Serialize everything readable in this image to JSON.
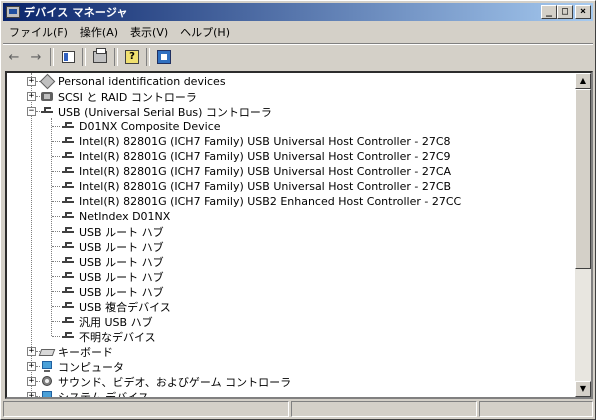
{
  "window": {
    "title": "デバイス マネージャ",
    "controls": {
      "minimize": "_",
      "maximize": "□",
      "close": "×"
    }
  },
  "menubar": {
    "items": [
      "ファイル(F)",
      "操作(A)",
      "表示(V)",
      "ヘルプ(H)"
    ]
  },
  "toolbar": {
    "back_icon": "back-arrow-icon",
    "forward_icon": "forward-arrow-icon",
    "buttons": [
      "properties-icon",
      "print-icon",
      "help-icon",
      "scan-hardware-icon"
    ],
    "back_glyph": "←",
    "forward_glyph": "→",
    "help_glyph": "?"
  },
  "tree": {
    "expand_collapsed": "+",
    "expand_open": "−",
    "nodes": [
      {
        "label": "Personal identification devices",
        "level": 0,
        "expander": "+",
        "icon": "diamond-icon"
      },
      {
        "label": "SCSI と RAID コントローラ",
        "level": 0,
        "expander": "+",
        "icon": "scsi-icon"
      },
      {
        "label": "USB (Universal Serial Bus) コントローラ",
        "level": 0,
        "expander": "−",
        "icon": "usb-icon"
      },
      {
        "label": "D01NX Composite Device",
        "level": 1,
        "icon": "usb-icon"
      },
      {
        "label": "Intel(R) 82801G (ICH7 Family) USB Universal Host Controller - 27C8",
        "level": 1,
        "icon": "usb-icon"
      },
      {
        "label": "Intel(R) 82801G (ICH7 Family) USB Universal Host Controller - 27C9",
        "level": 1,
        "icon": "usb-icon"
      },
      {
        "label": "Intel(R) 82801G (ICH7 Family) USB Universal Host Controller - 27CA",
        "level": 1,
        "icon": "usb-icon"
      },
      {
        "label": "Intel(R) 82801G (ICH7 Family) USB Universal Host Controller - 27CB",
        "level": 1,
        "icon": "usb-icon"
      },
      {
        "label": "Intel(R) 82801G (ICH7 Family) USB2 Enhanced Host Controller - 27CC",
        "level": 1,
        "icon": "usb-icon"
      },
      {
        "label": "NetIndex D01NX",
        "level": 1,
        "icon": "usb-icon"
      },
      {
        "label": "USB ルート ハブ",
        "level": 1,
        "icon": "usb-icon"
      },
      {
        "label": "USB ルート ハブ",
        "level": 1,
        "icon": "usb-icon"
      },
      {
        "label": "USB ルート ハブ",
        "level": 1,
        "icon": "usb-icon"
      },
      {
        "label": "USB ルート ハブ",
        "level": 1,
        "icon": "usb-icon"
      },
      {
        "label": "USB ルート ハブ",
        "level": 1,
        "icon": "usb-icon"
      },
      {
        "label": "USB 複合デバイス",
        "level": 1,
        "icon": "usb-icon"
      },
      {
        "label": "汎用 USB ハブ",
        "level": 1,
        "icon": "usb-icon"
      },
      {
        "label": "不明なデバイス",
        "level": 1,
        "icon": "usb-icon"
      },
      {
        "label": "キーボード",
        "level": 0,
        "expander": "+",
        "icon": "keyboard-icon"
      },
      {
        "label": "コンピュータ",
        "level": 0,
        "expander": "+",
        "icon": "computer-icon"
      },
      {
        "label": "サウンド、ビデオ、およびゲーム コントローラ",
        "level": 0,
        "expander": "+",
        "icon": "sound-icon"
      },
      {
        "label": "システム デバイス",
        "level": 0,
        "expander": "+",
        "icon": "computer-icon"
      }
    ]
  },
  "scrollbar": {
    "up": "▲",
    "down": "▼",
    "scroll_position": 0.3
  }
}
